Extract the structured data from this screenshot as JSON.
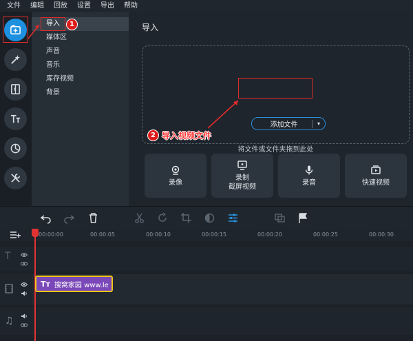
{
  "menu": [
    "文件",
    "编辑",
    "回放",
    "设置",
    "导出",
    "帮助"
  ],
  "rail": {
    "buttons": [
      {
        "name": "import-icon",
        "active": true
      },
      {
        "name": "magic-wand-icon",
        "active": false
      },
      {
        "name": "transitions-icon",
        "active": false
      },
      {
        "name": "titles-icon",
        "active": false
      },
      {
        "name": "stickers-icon",
        "active": false
      },
      {
        "name": "tools-icon",
        "active": false
      }
    ]
  },
  "sections": [
    "导入",
    "媒体区",
    "声音",
    "音乐",
    "库存视频",
    "背景"
  ],
  "main": {
    "title": "导入",
    "add_button": "添加文件",
    "drop_hint": "将文件或文件夹拖到此处",
    "tiles": [
      {
        "label": "录像",
        "icon": "webcam-icon"
      },
      {
        "label": "录制\n截屏视频",
        "icon": "screen-record-icon"
      },
      {
        "label": "录音",
        "icon": "microphone-icon"
      },
      {
        "label": "快速视频",
        "icon": "quick-video-icon"
      }
    ]
  },
  "annotations": {
    "badge1": "1",
    "badge2": "2",
    "step2_text": "导入视频文件"
  },
  "timeline": {
    "ticks": [
      "00:00:00",
      "00:00:05",
      "00:00:10",
      "00:00:15",
      "00:00:20",
      "00:00:25",
      "00:00:30"
    ],
    "clip_icon": "Tт",
    "clip_text": "搜窝家园 www.le"
  },
  "colors": {
    "accent": "#1e90e0",
    "annotation_red": "#e12b2b",
    "clip_purple": "#7a48b8",
    "clip_border": "#f0c419"
  }
}
